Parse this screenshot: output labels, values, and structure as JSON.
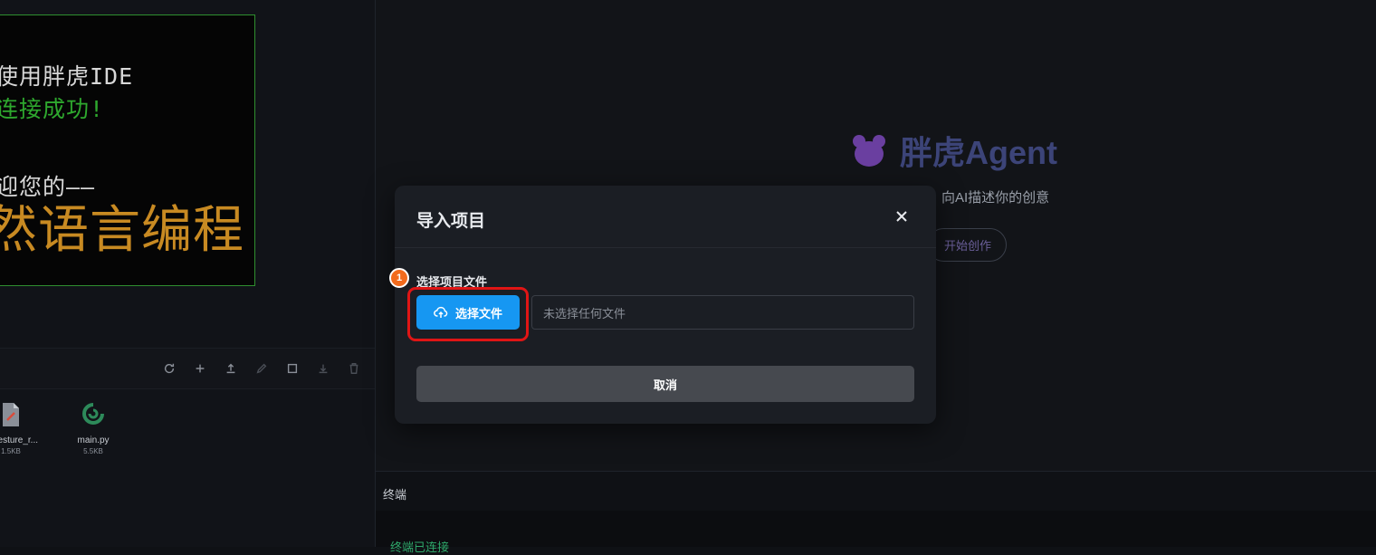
{
  "left_panel": {
    "screen": {
      "line1": "使用胖虎IDE",
      "line2": "连接成功!",
      "line3": "迎您的——",
      "line4": "然语言编程"
    },
    "toolbar_icons": [
      "refresh-icon",
      "plus-icon",
      "upload-icon",
      "edit-icon",
      "square-icon",
      "download-icon",
      "trash-icon"
    ],
    "files": [
      {
        "name": "gesture_r...",
        "size": "1.5KB",
        "icon": "file-icon"
      },
      {
        "name": "main.py",
        "size": "5.5KB",
        "icon": "python-file-icon"
      }
    ]
  },
  "agent": {
    "title": "胖虎Agent",
    "subtitle": "向AI描述你的创意",
    "start_label": "开始创作",
    "icon": "tiger-paw-icon"
  },
  "terminal": {
    "header": "终端",
    "status": "终端已连接"
  },
  "modal": {
    "title": "导入项目",
    "field_label": "选择项目文件",
    "select_button": "选择文件",
    "file_placeholder": "未选择任何文件",
    "cancel_label": "取消",
    "step_number": "1"
  },
  "colors": {
    "accent": "#1697f2",
    "highlight": "#e01515",
    "badge": "#f26b1d"
  }
}
